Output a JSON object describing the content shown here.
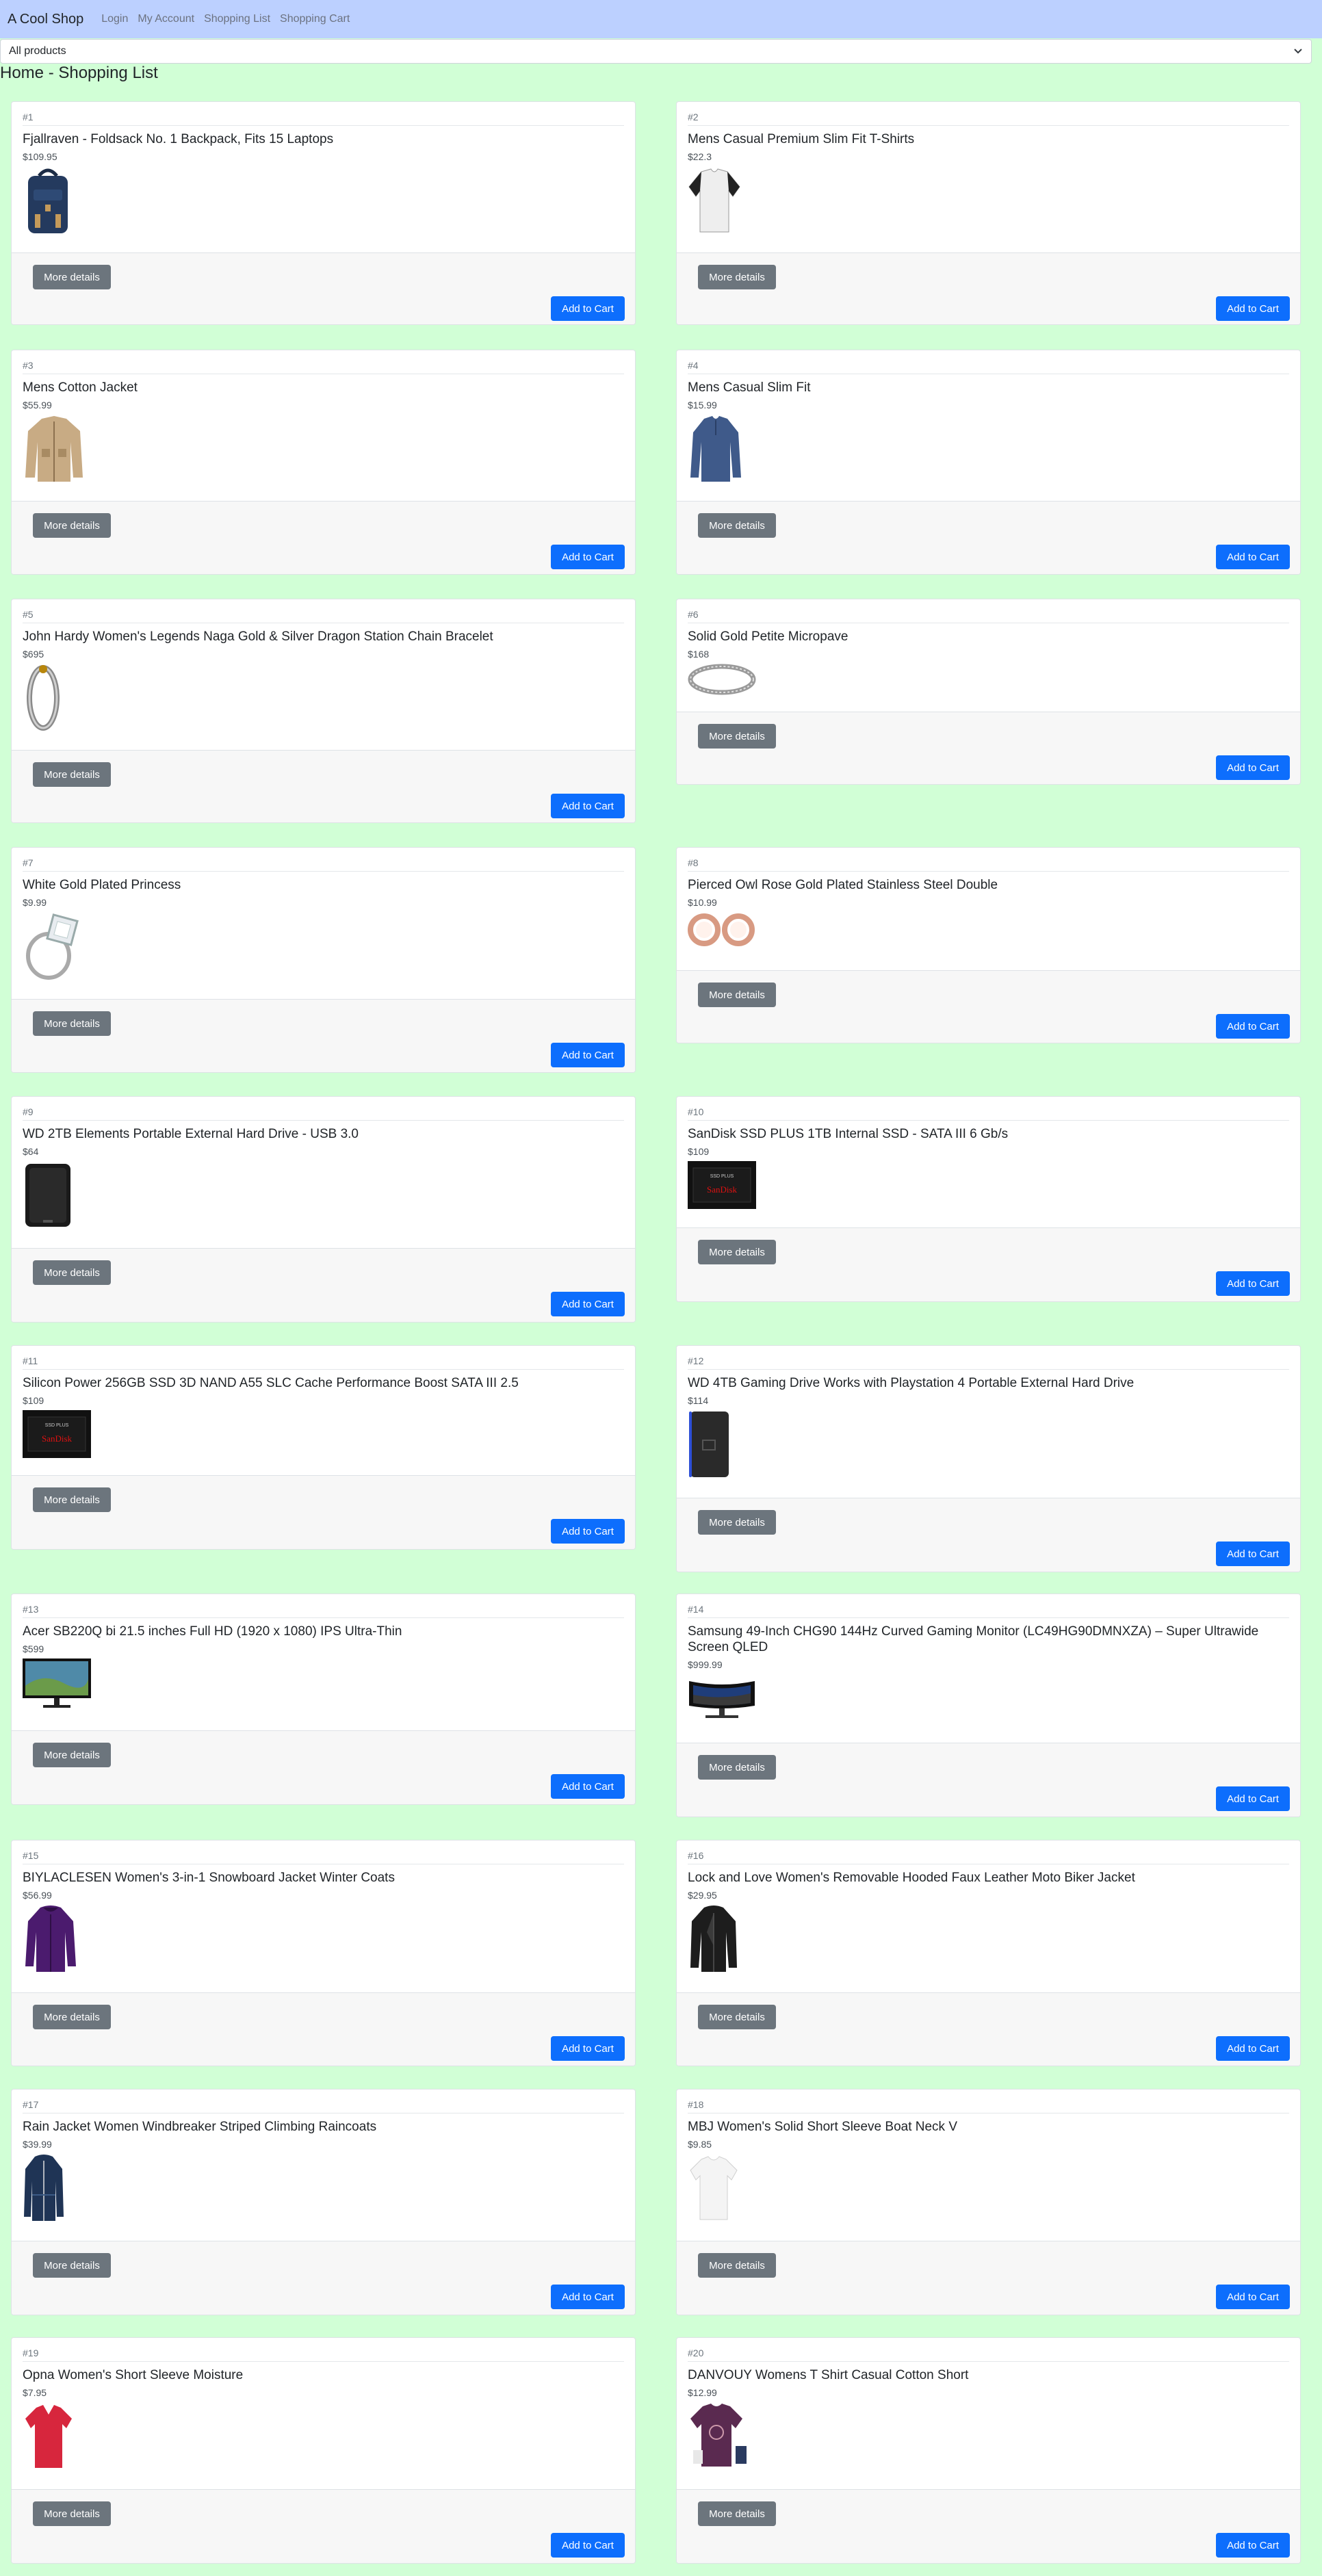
{
  "navbar": {
    "brand": "A Cool Shop",
    "links": [
      "Login",
      "My Account",
      "Shopping List",
      "Shopping Cart"
    ]
  },
  "filter": {
    "selected": "All products"
  },
  "page": {
    "title": "Home - Shopping List"
  },
  "buttons": {
    "details": "More details",
    "cart": "Add to Cart"
  },
  "products": [
    {
      "num": "#1",
      "name": "Fjallraven - Foldsack No. 1 Backpack, Fits 15 Laptops",
      "price": "$109.95",
      "icon": "backpack-image"
    },
    {
      "num": "#2",
      "name": "Mens Casual Premium Slim Fit T-Shirts",
      "price": "$22.3",
      "icon": "tshirt-image"
    },
    {
      "num": "#3",
      "name": "Mens Cotton Jacket",
      "price": "$55.99",
      "icon": "jacket-image"
    },
    {
      "num": "#4",
      "name": "Mens Casual Slim Fit",
      "price": "$15.99",
      "icon": "long-sleeve-shirt-image"
    },
    {
      "num": "#5",
      "name": "John Hardy Women's Legends Naga Gold & Silver Dragon Station Chain Bracelet",
      "price": "$695",
      "icon": "bracelet-image"
    },
    {
      "num": "#6",
      "name": "Solid Gold Petite Micropave",
      "price": "$168",
      "icon": "ring-band-image"
    },
    {
      "num": "#7",
      "name": "White Gold Plated Princess",
      "price": "$9.99",
      "icon": "diamond-ring-image"
    },
    {
      "num": "#8",
      "name": "Pierced Owl Rose Gold Plated Stainless Steel Double",
      "price": "$10.99",
      "icon": "rose-gold-earrings-image"
    },
    {
      "num": "#9",
      "name": "WD 2TB Elements Portable External Hard Drive - USB 3.0",
      "price": "$64",
      "icon": "hard-drive-image"
    },
    {
      "num": "#10",
      "name": "SanDisk SSD PLUS 1TB Internal SSD - SATA III 6 Gb/s",
      "price": "$109",
      "icon": "ssd-image"
    },
    {
      "num": "#11",
      "name": "Silicon Power 256GB SSD 3D NAND A55 SLC Cache Performance Boost SATA III 2.5",
      "price": "$109",
      "icon": "ssd-image"
    },
    {
      "num": "#12",
      "name": "WD 4TB Gaming Drive Works with Playstation 4 Portable External Hard Drive",
      "price": "$114",
      "icon": "gaming-drive-image"
    },
    {
      "num": "#13",
      "name": "Acer SB220Q bi 21.5 inches Full HD (1920 x 1080) IPS Ultra-Thin",
      "price": "$599",
      "icon": "monitor-image"
    },
    {
      "num": "#14",
      "name": "Samsung 49-Inch CHG90 144Hz Curved Gaming Monitor (LC49HG90DMNXZA) – Super Ultrawide Screen QLED",
      "price": "$999.99",
      "icon": "curved-monitor-image"
    },
    {
      "num": "#15",
      "name": "BIYLACLESEN Women's 3-in-1 Snowboard Jacket Winter Coats",
      "price": "$56.99",
      "icon": "winter-jacket-image"
    },
    {
      "num": "#16",
      "name": "Lock and Love Women's Removable Hooded Faux Leather Moto Biker Jacket",
      "price": "$29.95",
      "icon": "leather-jacket-image"
    },
    {
      "num": "#17",
      "name": "Rain Jacket Women Windbreaker Striped Climbing Raincoats",
      "price": "$39.99",
      "icon": "raincoat-image"
    },
    {
      "num": "#18",
      "name": "MBJ Women's Solid Short Sleeve Boat Neck V",
      "price": "$9.85",
      "icon": "white-top-image"
    },
    {
      "num": "#19",
      "name": "Opna Women's Short Sleeve Moisture",
      "price": "$7.95",
      "icon": "red-tshirt-image"
    },
    {
      "num": "#20",
      "name": "DANVOUY Womens T Shirt Casual Cotton Short",
      "price": "$12.99",
      "icon": "purple-tshirt-image"
    }
  ]
}
